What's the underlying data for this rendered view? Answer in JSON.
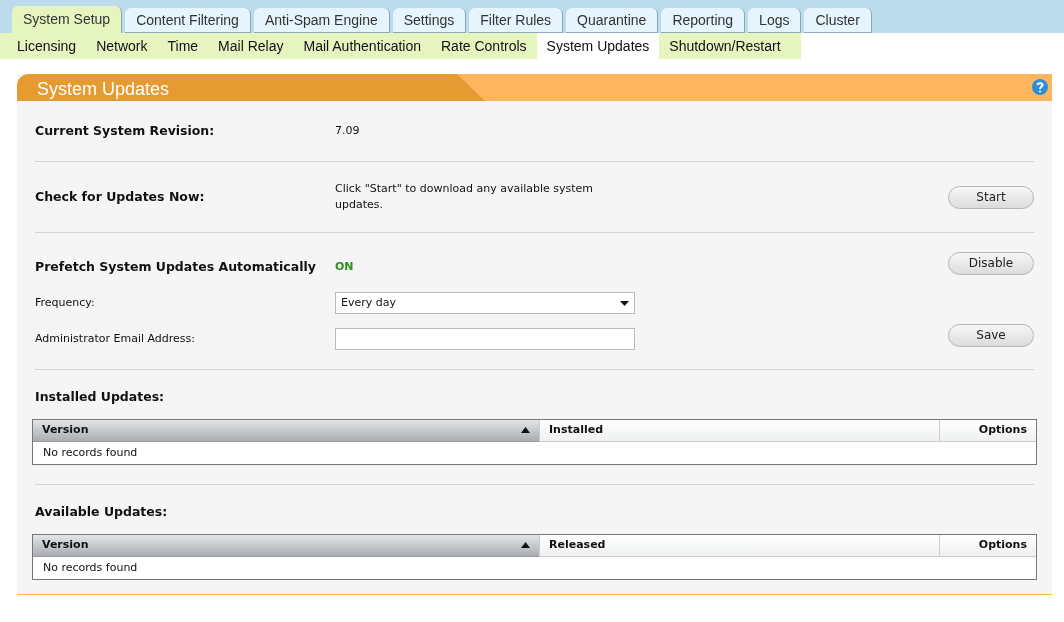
{
  "main_tabs": [
    {
      "label": "System Setup",
      "selected": true
    },
    {
      "label": "Content Filtering",
      "selected": false
    },
    {
      "label": "Anti-Spam Engine",
      "selected": false
    },
    {
      "label": "Settings",
      "selected": false
    },
    {
      "label": "Filter Rules",
      "selected": false
    },
    {
      "label": "Quarantine",
      "selected": false
    },
    {
      "label": "Reporting",
      "selected": false
    },
    {
      "label": "Logs",
      "selected": false
    },
    {
      "label": "Cluster",
      "selected": false
    }
  ],
  "sub_tabs": [
    {
      "label": "Licensing",
      "selected": false
    },
    {
      "label": "Network",
      "selected": false
    },
    {
      "label": "Time",
      "selected": false
    },
    {
      "label": "Mail Relay",
      "selected": false
    },
    {
      "label": "Mail Authentication",
      "selected": false
    },
    {
      "label": "Rate Controls",
      "selected": false
    },
    {
      "label": "System Updates",
      "selected": true
    },
    {
      "label": "Shutdown/Restart",
      "selected": false
    }
  ],
  "panel": {
    "title": "System Updates",
    "revision": {
      "label": "Current System Revision:",
      "value": "7.09"
    },
    "check": {
      "label": "Check for Updates Now:",
      "description": "Click \"Start\" to download any available system updates.",
      "button": "Start"
    },
    "prefetch": {
      "label": "Prefetch System Updates Automatically",
      "status": "ON",
      "on": true,
      "button": "Disable"
    },
    "frequency": {
      "label": "Frequency:",
      "value": "Every day"
    },
    "email": {
      "label": "Administrator Email Address:",
      "button": "Save"
    },
    "tables": [
      {
        "title": "Installed Updates:",
        "columns": [
          {
            "label": "Version",
            "sorted": true
          },
          {
            "label": "Installed",
            "sorted": false
          },
          {
            "label": "Options",
            "sorted": false
          }
        ],
        "empty": "No records found"
      },
      {
        "title": "Available Updates:",
        "columns": [
          {
            "label": "Version",
            "sorted": true
          },
          {
            "label": "Released",
            "sorted": false
          },
          {
            "label": "Options",
            "sorted": false
          }
        ],
        "empty": "No records found"
      }
    ]
  }
}
